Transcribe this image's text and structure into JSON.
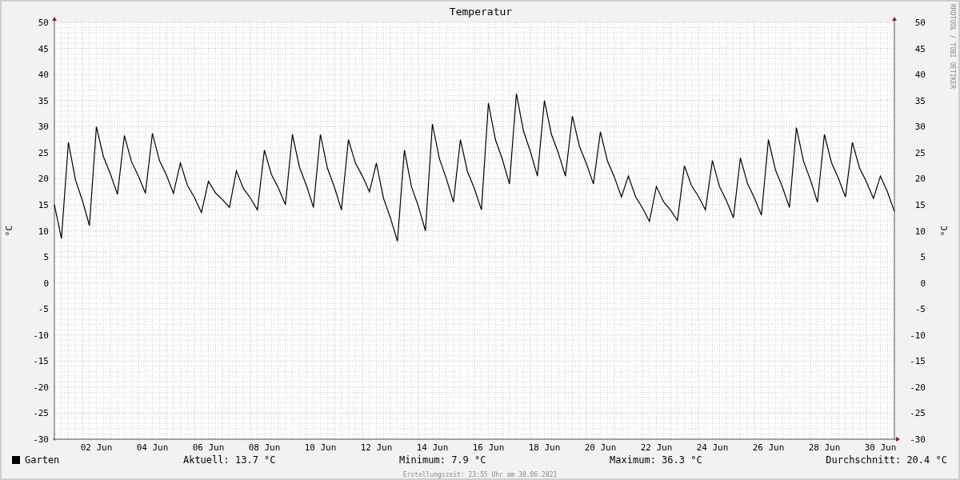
{
  "chart": {
    "watermark": "RRDTOOL / TOBI OETIKER",
    "right_ylabel": "°C",
    "right_yticks": [
      "50",
      "45",
      "40",
      "35",
      "30",
      "25",
      "20",
      "15",
      "10",
      "5",
      "0",
      "-5",
      "-10",
      "-15",
      "-20",
      "-25",
      "-30"
    ],
    "chart_data": {
      "type": "line",
      "grid": true,
      "title": "Temperatur",
      "ylabel": "°C",
      "ylim": [
        -30,
        50
      ],
      "yticks": [
        50,
        45,
        40,
        35,
        30,
        25,
        20,
        15,
        10,
        5,
        0,
        -5,
        -10,
        -15,
        -20,
        -25,
        -30
      ],
      "categories": [
        null,
        null,
        null,
        null,
        null,
        null,
        "02 Jun",
        null,
        null,
        null,
        null,
        null,
        null,
        null,
        "04 Jun",
        null,
        null,
        null,
        null,
        null,
        null,
        null,
        "06 Jun",
        null,
        null,
        null,
        null,
        null,
        null,
        null,
        "08 Jun",
        null,
        null,
        null,
        null,
        null,
        null,
        null,
        "10 Jun",
        null,
        null,
        null,
        null,
        null,
        null,
        null,
        "12 Jun",
        null,
        null,
        null,
        null,
        null,
        null,
        null,
        "14 Jun",
        null,
        null,
        null,
        null,
        null,
        null,
        null,
        "16 Jun",
        null,
        null,
        null,
        null,
        null,
        null,
        null,
        "18 Jun",
        null,
        null,
        null,
        null,
        null,
        null,
        null,
        "20 Jun",
        null,
        null,
        null,
        null,
        null,
        null,
        null,
        "22 Jun",
        null,
        null,
        null,
        null,
        null,
        null,
        null,
        "24 Jun",
        null,
        null,
        null,
        null,
        null,
        null,
        null,
        "26 Jun",
        null,
        null,
        null,
        null,
        null,
        null,
        null,
        "28 Jun",
        null,
        null,
        null,
        null,
        null,
        null,
        null,
        "30 Jun",
        null,
        null
      ],
      "series": [
        {
          "name": "Garten",
          "color": "#000000",
          "values": [
            15,
            8.5,
            27,
            19.8,
            15.8,
            11,
            30,
            24.2,
            20.9,
            17,
            28.3,
            23.3,
            20.5,
            17.2,
            28.7,
            23.5,
            20.7,
            17.2,
            23,
            18.7,
            16.4,
            13.5,
            19.5,
            17.3,
            16,
            14.5,
            21.5,
            18.1,
            16.3,
            14,
            25.5,
            20.8,
            18.2,
            15,
            28.5,
            22.2,
            18.7,
            14.5,
            28.5,
            22,
            18.4,
            14,
            27.5,
            23,
            20.5,
            17.5,
            23,
            16.3,
            12.5,
            8,
            25.5,
            18.5,
            14.7,
            10,
            30.5,
            23.8,
            20,
            15.5,
            27.5,
            21.4,
            18.1,
            14,
            34.5,
            27.5,
            23.7,
            19,
            36.3,
            29.2,
            25.2,
            20.5,
            35,
            28.5,
            24.9,
            20.5,
            32,
            26.2,
            22.9,
            19,
            29,
            23.4,
            20.3,
            16.5,
            20.5,
            16.6,
            14.4,
            11.8,
            18.5,
            15.6,
            14,
            12,
            22.5,
            18.7,
            16.6,
            14,
            23.5,
            18.5,
            15.8,
            12.5,
            24,
            19.1,
            16.3,
            13,
            27.5,
            21.7,
            18.4,
            14.5,
            29.8,
            23.4,
            19.8,
            15.5,
            28.5,
            23.1,
            20.1,
            16.5,
            27,
            22.1,
            19.4,
            16.2,
            20.5,
            17.5,
            13.7
          ]
        }
      ]
    }
  },
  "legend": {
    "stats": [
      "Aktuell: 13.7 °C",
      "Minimum: 7.9 °C",
      "Maximum: 36.3 °C",
      "Durchschnitt: 20.4 °C"
    ]
  },
  "footer": "Erstellungszeit: 23:55 Uhr am 30.06.2021"
}
